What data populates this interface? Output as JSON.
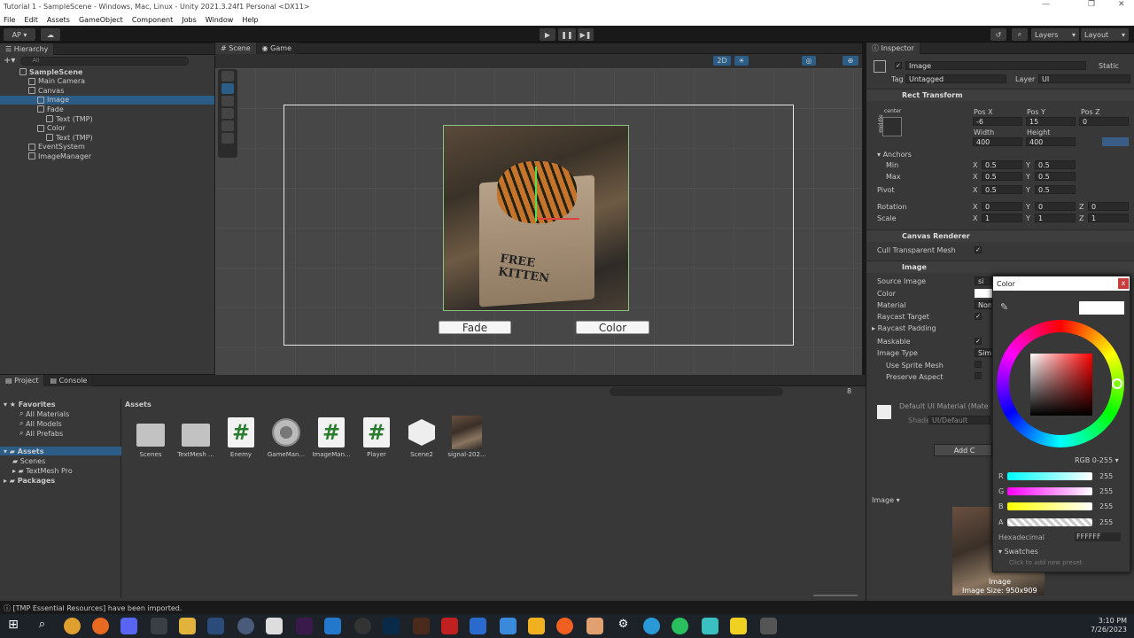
{
  "window": {
    "title": "Tutorial 1 - SampleScene - Windows, Mac, Linux - Unity 2021.3.24f1 Personal <DX11>"
  },
  "menu": [
    "File",
    "Edit",
    "Assets",
    "GameObject",
    "Component",
    "Jobs",
    "Window",
    "Help"
  ],
  "toolbar": {
    "account": "AP",
    "layers": "Layers",
    "layout": "Layout"
  },
  "hierarchy": {
    "tab": "Hierarchy",
    "search_placeholder": "All",
    "items": [
      {
        "label": "SampleScene",
        "depth": 0
      },
      {
        "label": "Main Camera",
        "depth": 1
      },
      {
        "label": "Canvas",
        "depth": 1
      },
      {
        "label": "Image",
        "depth": 2,
        "selected": true
      },
      {
        "label": "Fade",
        "depth": 2
      },
      {
        "label": "Text (TMP)",
        "depth": 3
      },
      {
        "label": "Color",
        "depth": 2
      },
      {
        "label": "Text (TMP)",
        "depth": 3
      },
      {
        "label": "EventSystem",
        "depth": 1
      },
      {
        "label": "ImageManager",
        "depth": 1
      }
    ]
  },
  "scene": {
    "tabs": [
      "Scene",
      "Game"
    ],
    "mode2d": "2D",
    "image_text": "FREE KITTEN",
    "fade_button": "Fade",
    "color_button": "Color"
  },
  "project": {
    "tabs": [
      "Project",
      "Console"
    ],
    "favorites": "Favorites",
    "fav_items": [
      "All Materials",
      "All Models",
      "All Prefabs"
    ],
    "assets_root": "Assets",
    "asset_folders": [
      "Scenes",
      "TextMesh Pro"
    ],
    "packages": "Packages",
    "breadcrumb": "Assets",
    "count": "8",
    "assets": [
      {
        "label": "Scenes",
        "kind": "folder"
      },
      {
        "label": "TextMesh ...",
        "kind": "folder"
      },
      {
        "label": "Enemy",
        "kind": "script"
      },
      {
        "label": "GameMan...",
        "kind": "gear"
      },
      {
        "label": "ImageMan...",
        "kind": "script"
      },
      {
        "label": "Player",
        "kind": "script"
      },
      {
        "label": "Scene2",
        "kind": "unity"
      },
      {
        "label": "signal-202...",
        "kind": "image"
      }
    ]
  },
  "inspector": {
    "tab": "Inspector",
    "name": "Image",
    "static": "Static",
    "tag_label": "Tag",
    "tag": "Untagged",
    "layer_label": "Layer",
    "layer": "UI",
    "rect": {
      "title": "Rect Transform",
      "anchor": "center",
      "anchor_side": "middle",
      "posx_l": "Pos X",
      "posy_l": "Pos Y",
      "posz_l": "Pos Z",
      "posx": "-6",
      "posy": "15",
      "posz": "0",
      "width_l": "Width",
      "height_l": "Height",
      "width": "400",
      "height": "400",
      "anchors": "Anchors",
      "min": "Min",
      "max": "Max",
      "pivot": "Pivot",
      "rotation": "Rotation",
      "scale": "Scale",
      "x": "X",
      "y": "Y",
      "z": "Z",
      "half": "0.5",
      "zero": "0",
      "one": "1"
    },
    "canvas_renderer": {
      "title": "Canvas Renderer",
      "cull": "Cull Transparent Mesh"
    },
    "image": {
      "title": "Image",
      "source": "Source Image",
      "source_val": "si",
      "color": "Color",
      "material": "Material",
      "material_val": "None",
      "raycast": "Raycast Target",
      "padding": "Raycast Padding",
      "maskable": "Maskable",
      "type": "Image Type",
      "type_val": "Simp",
      "use_sprite": "Use Sprite Mesh",
      "preserve": "Preserve Aspect"
    },
    "material": {
      "name": "Default UI Material (Mate",
      "shader_l": "Shader",
      "shader": "UI/Default",
      "add": "Add C"
    },
    "preview": {
      "label": "Image",
      "caption": "Image",
      "size": "Image Size: 950x909"
    }
  },
  "color_picker": {
    "title": "Color",
    "mode": "RGB 0-255",
    "r_label": "R",
    "g_label": "G",
    "b_label": "B",
    "a_label": "A",
    "r": "255",
    "g": "255",
    "b": "255",
    "a": "255",
    "hex_label": "Hexadecimal",
    "hex": "FFFFFF",
    "swatches": "Swatches",
    "swatch_hint": "Click to add new preset"
  },
  "status": {
    "message": "[TMP Essential Resources] have been imported."
  },
  "taskbar": {
    "time": "3:10 PM",
    "date": "7/26/2023"
  }
}
